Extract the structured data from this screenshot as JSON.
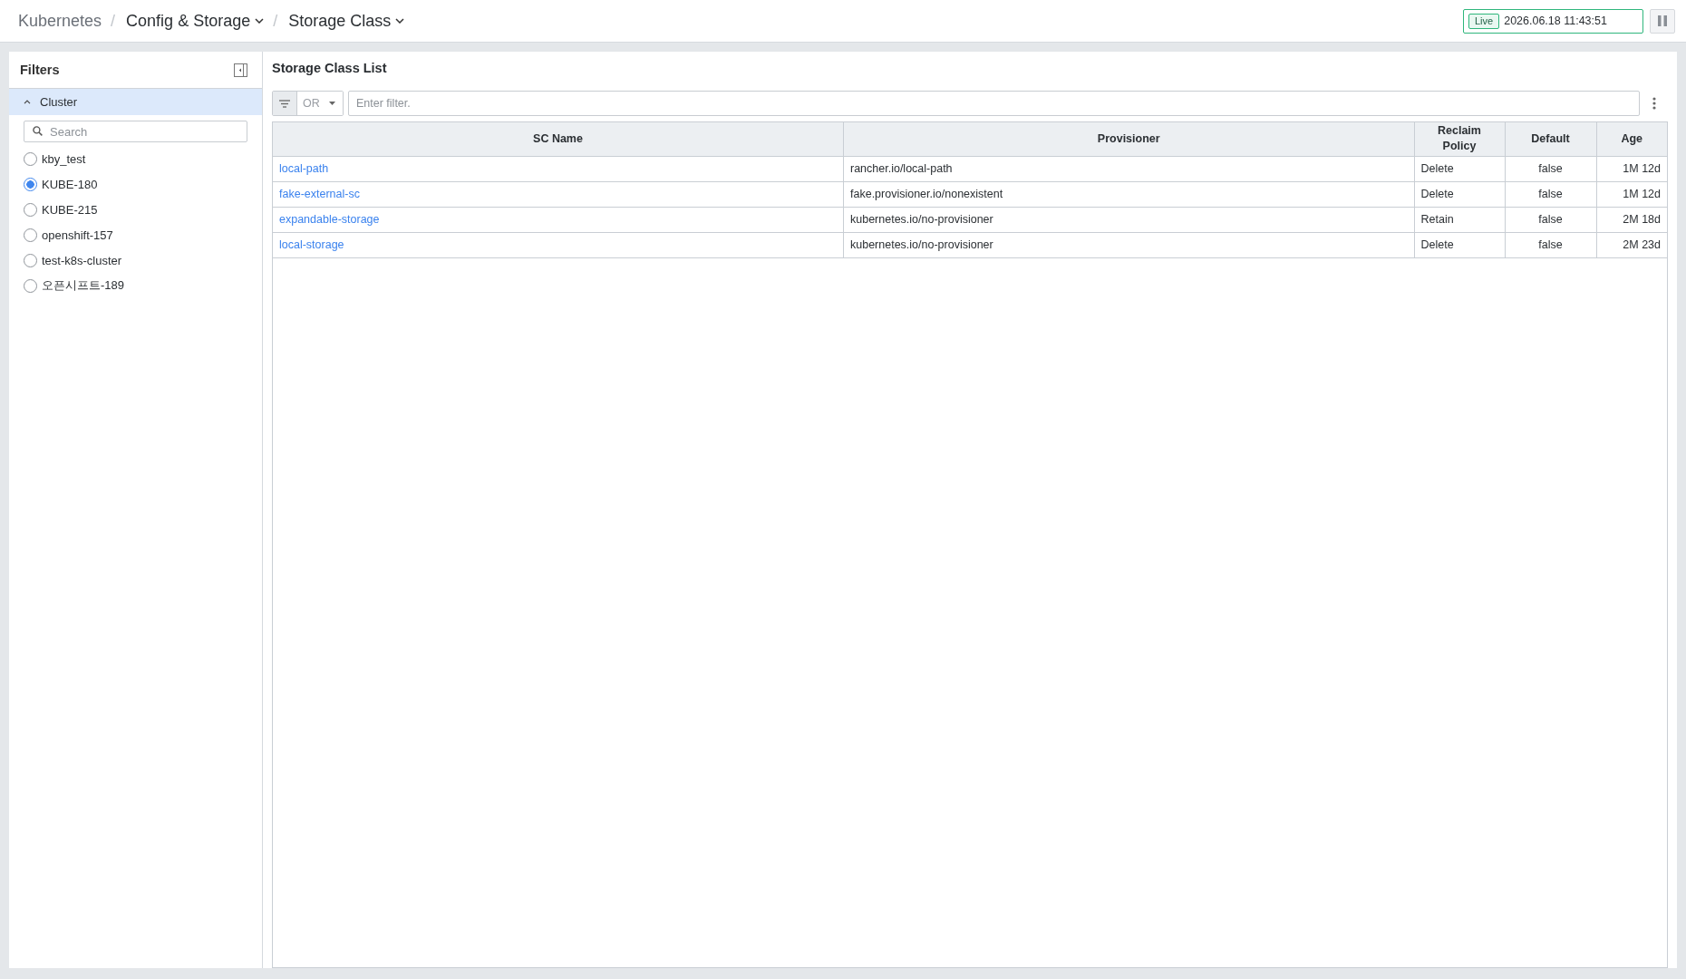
{
  "breadcrumb": [
    {
      "label": "Kubernetes",
      "kind": "link"
    },
    {
      "separator": "/",
      "label": "Config & Storage",
      "kind": "dropdown"
    },
    {
      "separator": "/",
      "label": "Storage Class",
      "kind": "dropdown"
    }
  ],
  "live_status": {
    "badge": "Live",
    "timestamp": "2026.06.18 11:43:51"
  },
  "filters": {
    "title": "Filters",
    "group": {
      "label": "Cluster",
      "expanded": true,
      "search": {
        "placeholder": "Search"
      },
      "options": [
        {
          "label": "kby_test",
          "selected": false
        },
        {
          "label": "KUBE-180",
          "selected": true
        },
        {
          "label": "KUBE-215",
          "selected": false
        },
        {
          "label": "openshift-157",
          "selected": false
        },
        {
          "label": "test-k8s-cluster",
          "selected": false
        },
        {
          "label": "오픈시프트-189",
          "selected": false
        }
      ]
    }
  },
  "storage_class_list": {
    "title": "Storage Class List",
    "filter_bar": {
      "operator": "OR",
      "placeholder": "Enter filter."
    },
    "table": {
      "columns": [
        "SC Name",
        "Provisioner",
        "Reclaim Policy",
        "Default",
        "Age"
      ],
      "rows": [
        {
          "sc_name": "local-path",
          "provisioner": "rancher.io/local-path",
          "reclaim_policy": "Delete",
          "default": "false",
          "age": "1M 12d"
        },
        {
          "sc_name": "fake-external-sc",
          "provisioner": "fake.provisioner.io/nonexistent",
          "reclaim_policy": "Delete",
          "default": "false",
          "age": "1M 12d"
        },
        {
          "sc_name": "expandable-storage",
          "provisioner": "kubernetes.io/no-provisioner",
          "reclaim_policy": "Retain",
          "default": "false",
          "age": "2M 18d"
        },
        {
          "sc_name": "local-storage",
          "provisioner": "kubernetes.io/no-provisioner",
          "reclaim_policy": "Delete",
          "default": "false",
          "age": "2M 23d"
        }
      ]
    }
  }
}
